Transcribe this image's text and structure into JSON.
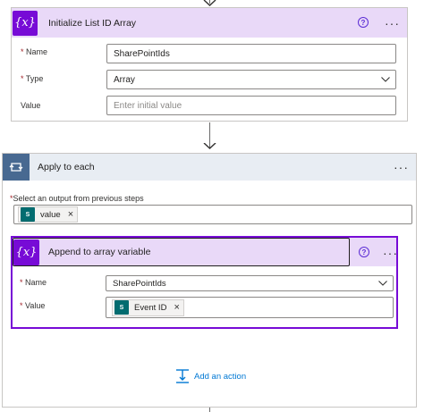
{
  "init_card": {
    "title": "Initialize List ID Array",
    "icon": "{x}",
    "help": "?",
    "more": "···",
    "fields": [
      {
        "required": "*",
        "label": "Name",
        "value": "SharePointIds"
      },
      {
        "required": "*",
        "label": "Type",
        "value": "Array"
      },
      {
        "required": "",
        "label": "Value",
        "placeholder": "Enter initial value"
      }
    ]
  },
  "apply_each": {
    "title": "Apply to each",
    "more": "···",
    "select_label_req": "*",
    "select_label": "Select an output from previous steps",
    "token": {
      "label": "value",
      "remove": "×"
    }
  },
  "append_card": {
    "title": "Append to array variable",
    "icon": "{x}",
    "help": "?",
    "more": "···",
    "fields": [
      {
        "required": "*",
        "label": "Name",
        "value": "SharePointIds"
      },
      {
        "required": "*",
        "label": "Value",
        "token": "Event ID",
        "remove": "×"
      }
    ]
  },
  "add_action": {
    "label": "Add an action"
  },
  "colors": {
    "variable": "#770bd6",
    "loop": "#486991",
    "link": "#0078d4",
    "sharepoint": "#036c70"
  }
}
